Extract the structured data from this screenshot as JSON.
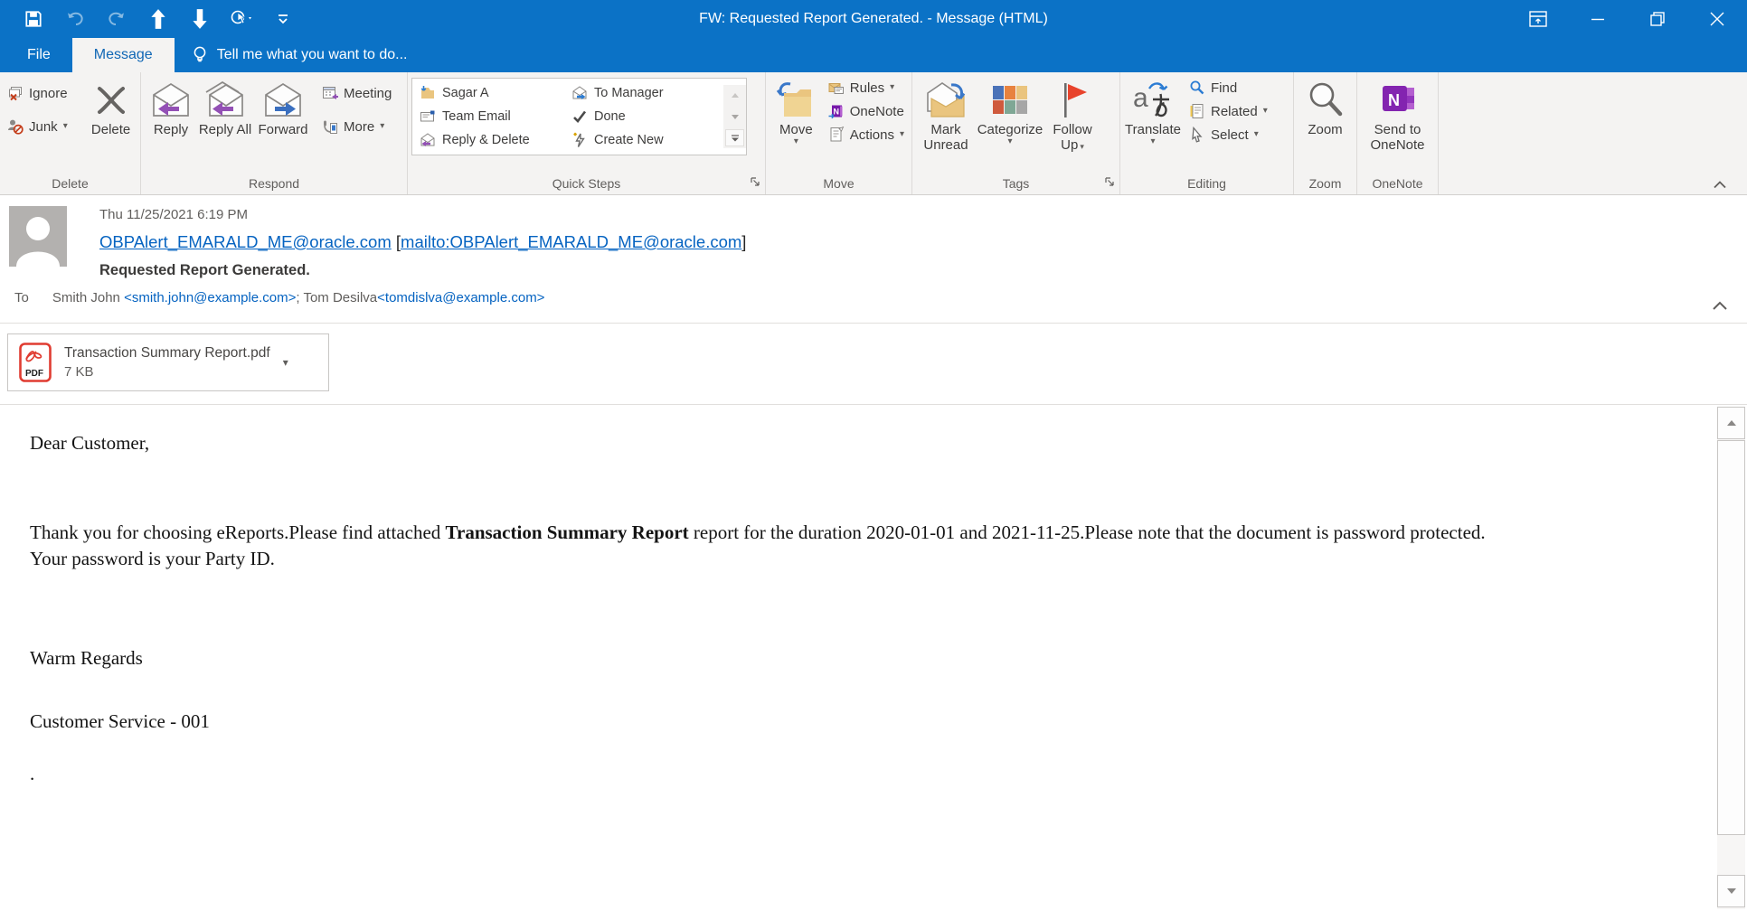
{
  "window": {
    "title": "FW: Requested Report Generated. - Message (HTML)"
  },
  "tabs": {
    "file": "File",
    "message": "Message",
    "tell_me": "Tell me what you want to do..."
  },
  "ribbon": {
    "groups": {
      "delete": {
        "label": "Delete",
        "ignore": "Ignore",
        "junk": "Junk",
        "delete_btn": "Delete"
      },
      "respond": {
        "label": "Respond",
        "reply": "Reply",
        "reply_all": "Reply All",
        "forward": "Forward",
        "meeting": "Meeting",
        "more": "More"
      },
      "quick_steps": {
        "label": "Quick Steps",
        "items": [
          "Sagar A",
          "Team Email",
          "Reply & Delete",
          "To Manager",
          "Done",
          "Create New"
        ]
      },
      "move": {
        "label": "Move",
        "move_btn": "Move",
        "rules": "Rules",
        "onenote": "OneNote",
        "actions": "Actions"
      },
      "tags": {
        "label": "Tags",
        "mark_unread": "Mark Unread",
        "categorize": "Categorize",
        "follow_up": "Follow Up"
      },
      "editing": {
        "label": "Editing",
        "translate": "Translate",
        "find": "Find",
        "related": "Related",
        "select": "Select"
      },
      "zoom": {
        "label": "Zoom",
        "zoom_btn": "Zoom"
      },
      "onenote": {
        "label": "OneNote",
        "send_to": "Send to OneNote"
      }
    }
  },
  "header": {
    "date": "Thu 11/25/2021 6:19 PM",
    "from_link": "OBPAlert_EMARALD_ME@oracle.com",
    "mailto_open": "[",
    "mailto_link": "mailto:OBPAlert_EMARALD_ME@oracle.com",
    "mailto_close": "]",
    "subject": "Requested Report Generated.",
    "to_label": "To",
    "recipient1_name": "Smith John ",
    "recipient1_email": "<smith.john@example.com>",
    "recipient_separator": "; Tom Desilva",
    "recipient2_email": "<tomdislva@example.com>"
  },
  "attachment": {
    "filename": "Transaction Summary Report.pdf",
    "filesize": "7 KB",
    "badge": "PDF"
  },
  "body": {
    "greeting": "Dear Customer,",
    "para_before_bold": "Thank you for choosing eReports.Please find attached ",
    "para_bold": "Transaction Summary Report",
    "para_after_bold": " report for the duration 2020-01-01 and 2021-11-25.Please note that the document is password protected.",
    "para_line2": "Your password is your Party ID.",
    "closing": "Warm Regards",
    "signature": "Customer Service - 001",
    "trailing_dot": "."
  },
  "colors": {
    "titlebar_blue": "#0b72c6",
    "link_blue": "#0563c1",
    "ribbon_bg": "#f4f3f2"
  }
}
